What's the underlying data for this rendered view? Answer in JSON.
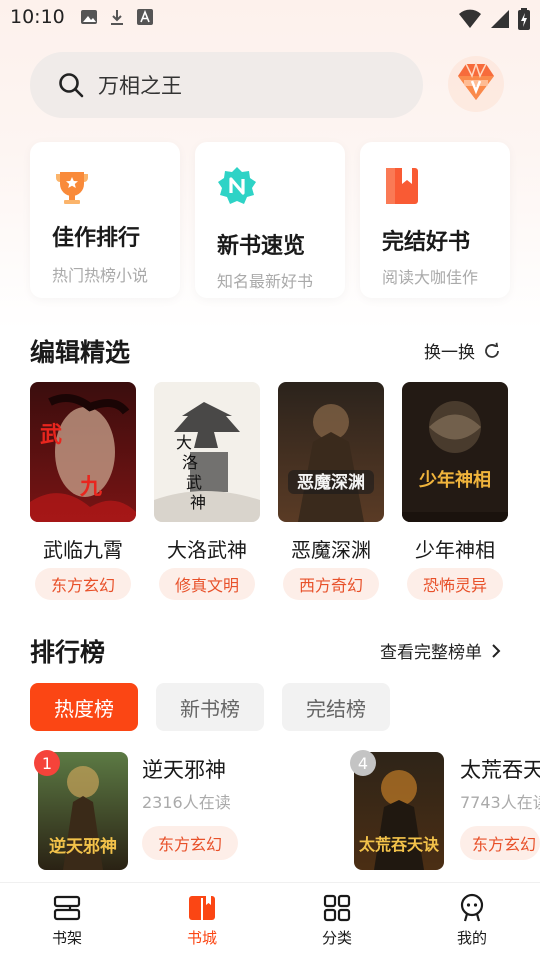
{
  "status": {
    "time": "10:10"
  },
  "search": {
    "query": "万相之王"
  },
  "quick": [
    {
      "title": "佳作排行",
      "sub": "热门热榜小说",
      "icon": "trophy-icon"
    },
    {
      "title": "新书速览",
      "sub": "知名最新好书",
      "icon": "new-badge-icon"
    },
    {
      "title": "完结好书",
      "sub": "阅读大咖佳作",
      "icon": "bookmark-book-icon"
    }
  ],
  "editor": {
    "title": "编辑精选",
    "refresh_label": "换一换",
    "books": [
      {
        "title": "武临九霄",
        "tag": "东方玄幻",
        "cover_text": "武临九霄"
      },
      {
        "title": "大洛武神",
        "tag": "修真文明",
        "cover_text": "大洛武神"
      },
      {
        "title": "恶魔深渊",
        "tag": "西方奇幻",
        "cover_text": "恶魔深渊"
      },
      {
        "title": "少年神相",
        "tag": "恐怖灵异",
        "cover_text": "少年神相"
      }
    ]
  },
  "ranking": {
    "title": "排行榜",
    "more_label": "查看完整榜单",
    "tabs": [
      "热度榜",
      "新书榜",
      "完结榜"
    ],
    "active_tab": 0,
    "items": [
      {
        "rank": "1",
        "title": "逆天邪神",
        "readers": "2316人在读",
        "tag": "东方玄幻",
        "cover_text": "逆天邪神"
      },
      {
        "rank": "4",
        "title": "太荒吞天诀",
        "readers": "7743人在读",
        "tag": "东方玄幻",
        "cover_text": "太荒吞天诀"
      }
    ]
  },
  "nav": [
    {
      "label": "书架",
      "icon": "bookshelf-icon"
    },
    {
      "label": "书城",
      "icon": "book-store-icon"
    },
    {
      "label": "分类",
      "icon": "category-grid-icon"
    },
    {
      "label": "我的",
      "icon": "profile-icon"
    }
  ],
  "nav_active": 1,
  "colors": {
    "accent": "#fb4614",
    "tag_text": "#e8512a",
    "tag_bg": "#fdeee8"
  }
}
